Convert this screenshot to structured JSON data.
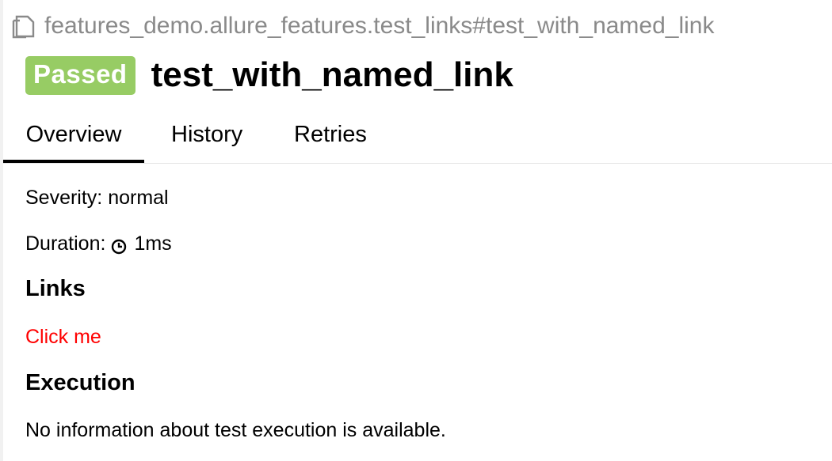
{
  "breadcrumb": {
    "icon": "copy-icon",
    "text": "features_demo.allure_features.test_links#test_with_named_link"
  },
  "header": {
    "status": "Passed",
    "title": "test_with_named_link"
  },
  "tabs": [
    {
      "label": "Overview",
      "active": true
    },
    {
      "label": "History",
      "active": false
    },
    {
      "label": "Retries",
      "active": false
    }
  ],
  "overview": {
    "severity": "Severity: normal",
    "duration_label": "Duration:",
    "duration_icon": "clock-icon",
    "duration_value": "1ms",
    "links_heading": "Links",
    "link_text": "Click me",
    "execution_heading": "Execution",
    "execution_text": "No information about test execution is available."
  },
  "colors": {
    "passed": "#97cc64",
    "link": "#ff0000",
    "muted": "#8a8a8a"
  }
}
